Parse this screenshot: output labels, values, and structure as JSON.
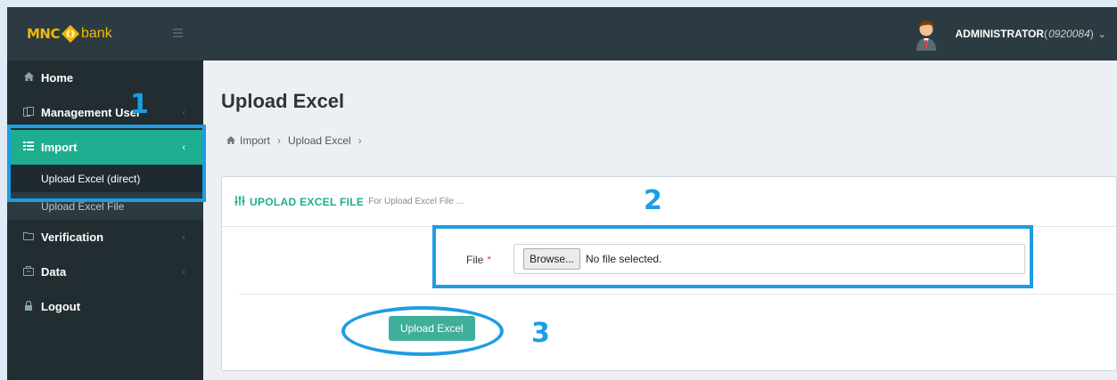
{
  "brand": {
    "mnc": "MNC",
    "bank": "bank"
  },
  "user": {
    "name": "ADMINISTRATOR",
    "open_paren": " (",
    "code": "0920084",
    "close_paren": ")"
  },
  "sidebar": {
    "items": [
      {
        "label": "Home",
        "icon": "home-icon"
      },
      {
        "label": "Management User",
        "icon": "users-icon"
      },
      {
        "label": "Import",
        "icon": "list-icon",
        "active": true
      },
      {
        "label": "Verification",
        "icon": "folder-icon"
      },
      {
        "label": "Data",
        "icon": "archive-icon"
      },
      {
        "label": "Logout",
        "icon": "lock-icon"
      }
    ],
    "import_submenu": [
      {
        "label": "Upload Excel (direct)",
        "current": true
      },
      {
        "label": "Upload Excel File"
      }
    ]
  },
  "page": {
    "title": "Upload Excel"
  },
  "breadcrumb": {
    "items": [
      "Import",
      "Upload Excel"
    ]
  },
  "form": {
    "box_title": "UPOLAD EXCEL FILE",
    "box_subtitle": "For Upload Excel File ...",
    "file_label": "File",
    "required_mark": "*",
    "browse_label": "Browse...",
    "file_status": "No file selected.",
    "submit_label": "Upload Excel"
  },
  "annotations": {
    "step1": "1",
    "step2": "2",
    "step3": "3"
  },
  "colors": {
    "accent": "#1fad8f",
    "annotation": "#1d9de2",
    "sidebar_bg": "#222d32",
    "topbar_bg": "#2c3b41",
    "button": "#3fae9a"
  }
}
